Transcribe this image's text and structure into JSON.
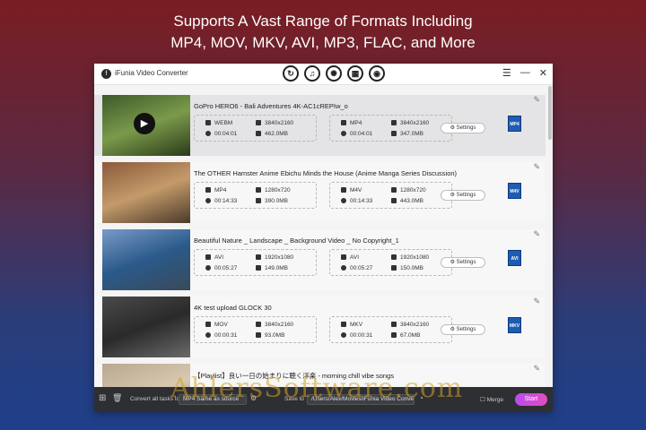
{
  "banner": {
    "line1": "Supports A Vast Range of Formats Including",
    "line2": "MP4, MOV, MKV, AVI, MP3, FLAC, and More"
  },
  "app": {
    "title": "iFunia Video Converter",
    "mode_icons": [
      "convert-icon",
      "audio-icon",
      "film-reel-icon",
      "film-strip-icon",
      "dvd-icon"
    ],
    "controls": {
      "menu": "☰",
      "minimize": "—",
      "close": "✕"
    }
  },
  "videos": [
    {
      "name": "GoPro HERO6 - Bali Adventures 4K-AC1cREPIw_o",
      "selected": true,
      "source": {
        "format": "WEBM",
        "duration": "00:04:01",
        "resolution": "3840x2160",
        "size": "462.0MB"
      },
      "output": {
        "format": "MP4",
        "duration": "00:04:01",
        "resolution": "3840x2160",
        "size": "347.0MB"
      },
      "settings_label": "Settings",
      "badge": "MP4",
      "thumb_colors": [
        "#3d5a2a",
        "#7a9a4a",
        "#2a3a1a"
      ]
    },
    {
      "name": "The OTHER Hamster Anime  Ebichu Minds the House (Anime Manga Series Discussion)",
      "selected": false,
      "source": {
        "format": "MP4",
        "duration": "00:14:33",
        "resolution": "1280x720",
        "size": "390.0MB"
      },
      "output": {
        "format": "M4V",
        "duration": "00:14:33",
        "resolution": "1280x720",
        "size": "443.0MB"
      },
      "settings_label": "Settings",
      "badge": "M4V",
      "thumb_colors": [
        "#8a5a3a",
        "#c49a6a",
        "#4a3a2a"
      ]
    },
    {
      "name": "Beautiful Nature _ Landscape _ Background Video _ No Copyright_1",
      "selected": false,
      "source": {
        "format": "AVI",
        "duration": "00:05:27",
        "resolution": "1920x1080",
        "size": "149.0MB"
      },
      "output": {
        "format": "AVI",
        "duration": "00:05:27",
        "resolution": "1920x1080",
        "size": "150.0MB"
      },
      "settings_label": "Settings",
      "badge": "AVI",
      "thumb_colors": [
        "#7a9ac8",
        "#2a5a8a",
        "#3a4a5a"
      ]
    },
    {
      "name": "4K test upload GLOCK 30",
      "selected": false,
      "source": {
        "format": "MOV",
        "duration": "00:00:31",
        "resolution": "3840x2160",
        "size": "93.0MB"
      },
      "output": {
        "format": "MKV",
        "duration": "00:00:31",
        "resolution": "3840x2160",
        "size": "67.0MB"
      },
      "settings_label": "Settings",
      "badge": "MKV",
      "thumb_colors": [
        "#4a4a4a",
        "#2a2a2a",
        "#6a6a6a"
      ]
    },
    {
      "name": "【Playlist】良い一日の始まりに聴く洋楽 - morning chill vibe songs",
      "selected": false,
      "thumb_colors": [
        "#b8a890",
        "#d8c8b0",
        "#8a7a6a"
      ]
    }
  ],
  "bottom": {
    "convert_all_label": "Convert all tasks to",
    "format_select": "MP4 Same as source",
    "save_to_label": "Save to",
    "save_path": "/Users/Alex/Movies/iFunia Video Converter",
    "merge_label": "Merge",
    "start_label": "Start"
  },
  "watermark": "AhlersSoftware.com"
}
